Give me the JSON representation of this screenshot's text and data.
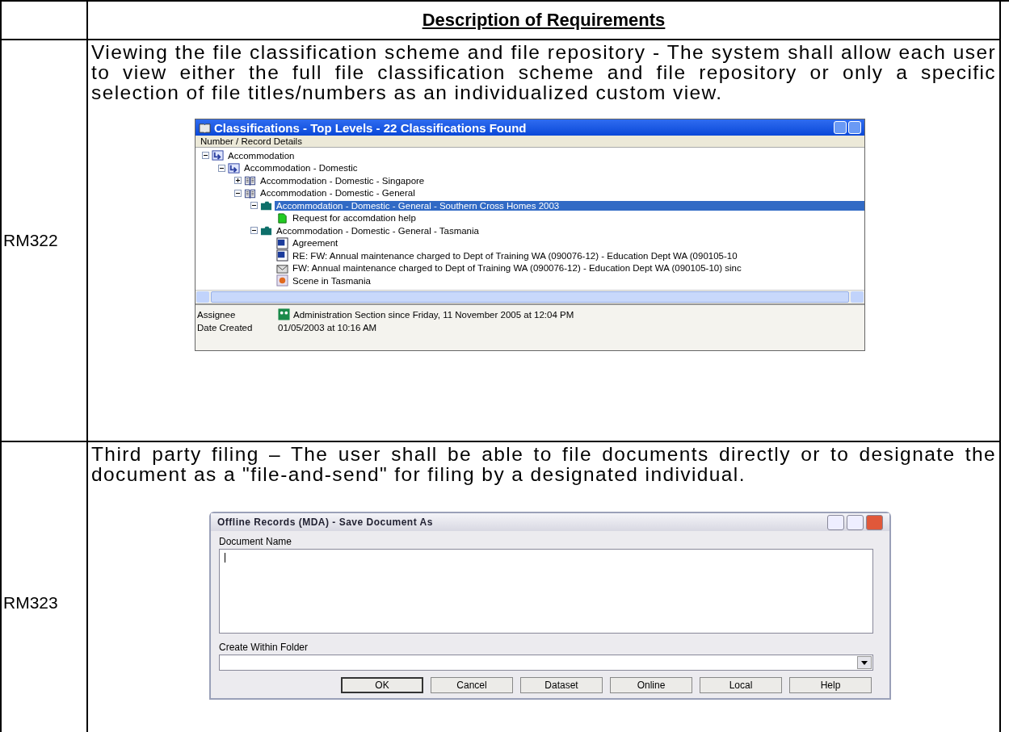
{
  "table": {
    "header": "Description of Requirements",
    "rows": [
      {
        "id": "RM322",
        "description": "Viewing the file classification scheme and file repository - The system shall allow each user to view either the full file classification scheme and file repository or only a specific selection of file titles/numbers as an individualized custom view.",
        "screenshot": {
          "kind": "tree",
          "title": "Classifications - Top Levels - 22 Classifications Found",
          "column_header": "Number / Record Details",
          "tree": [
            {
              "label": "Accommodation",
              "kind": "arrow-folder",
              "expanded": true,
              "selected": false,
              "children": [
                {
                  "label": "Accommodation - Domestic",
                  "kind": "arrow-folder",
                  "expanded": true,
                  "selected": false,
                  "children": [
                    {
                      "label": "Accommodation - Domestic - Singapore",
                      "kind": "book",
                      "expanded": false,
                      "selected": false
                    },
                    {
                      "label": "Accommodation - Domestic - General",
                      "kind": "book",
                      "expanded": true,
                      "selected": false,
                      "children": [
                        {
                          "label": "Accommodation - Domestic - General - Southern Cross Homes 2003",
                          "kind": "folder",
                          "expanded": true,
                          "selected": true,
                          "children": [
                            {
                              "label": "Request for accomdation help",
                              "kind": "record",
                              "selected": false
                            }
                          ]
                        },
                        {
                          "label": "Accommodation - Domestic - General - Tasmania",
                          "kind": "folder",
                          "expanded": true,
                          "selected": false,
                          "children": [
                            {
                              "label": "Agreement",
                              "kind": "word",
                              "selected": false
                            },
                            {
                              "label": "RE: FW: Annual maintenance charged to Dept of Training WA (090076-12) - Education Dept WA (090105-10",
                              "kind": "word",
                              "selected": false
                            },
                            {
                              "label": "FW: Annual maintenance charged to Dept of Training WA (090076-12) - Education Dept WA (090105-10) sinc",
                              "kind": "email",
                              "selected": false
                            },
                            {
                              "label": "Scene in Tasmania",
                              "kind": "image",
                              "selected": false
                            }
                          ]
                        }
                      ]
                    }
                  ]
                }
              ]
            }
          ],
          "details": [
            {
              "label": "Assignee",
              "value": "Administration Section since Friday, 11 November 2005 at 12:04 PM",
              "kind": "group"
            },
            {
              "label": "Date Created",
              "value": "01/05/2003 at 10:16 AM"
            }
          ]
        }
      },
      {
        "id": "RM323",
        "description": "Third party filing – The user shall be able to file documents directly or to designate the document as a \"file-and-send\" for filing by a designated individual.",
        "screenshot": {
          "kind": "dialog",
          "title": "Offline Records (MDA) - Save Document As",
          "name_label": "Document Name",
          "folder_label": "Create Within Folder",
          "buttons": [
            {
              "label": "OK",
              "default": true
            },
            {
              "label": "Cancel",
              "default": false
            },
            {
              "label": "Dataset",
              "default": false
            },
            {
              "label": "Online",
              "default": false
            },
            {
              "label": "Local",
              "default": false
            },
            {
              "label": "Help",
              "default": false
            }
          ]
        }
      }
    ]
  }
}
